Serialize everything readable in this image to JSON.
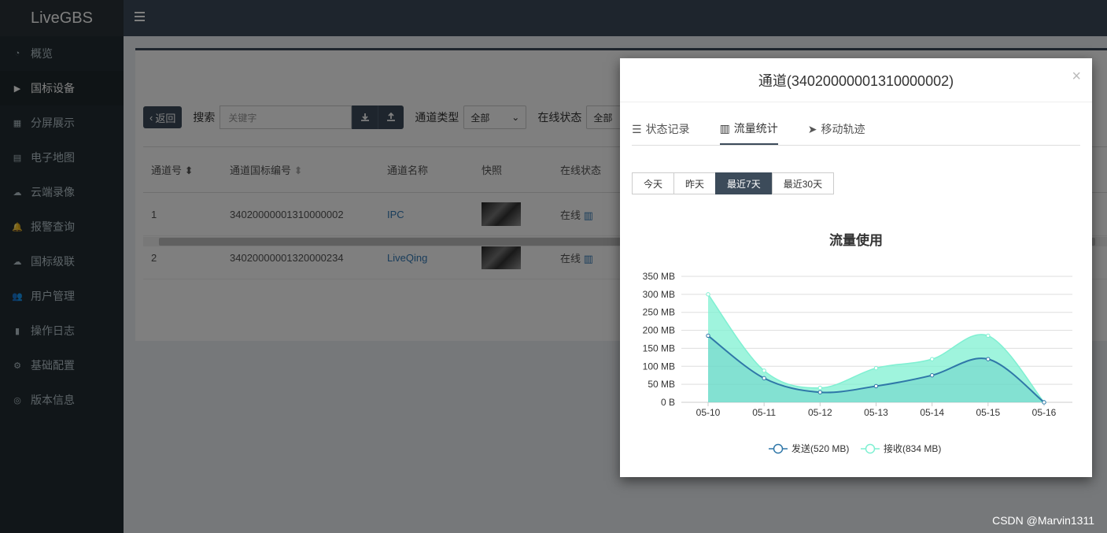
{
  "app": {
    "logo": "LiveGBS"
  },
  "sidebar": {
    "items": [
      {
        "label": "概览",
        "icon": "dashboard-icon"
      },
      {
        "label": "国标设备",
        "icon": "video-camera-icon"
      },
      {
        "label": "分屏展示",
        "icon": "grid-icon"
      },
      {
        "label": "电子地图",
        "icon": "map-icon"
      },
      {
        "label": "云端录像",
        "icon": "cloud-icon"
      },
      {
        "label": "报警查询",
        "icon": "bell-icon"
      },
      {
        "label": "国标级联",
        "icon": "cloud-upload-icon"
      },
      {
        "label": "用户管理",
        "icon": "users-icon"
      },
      {
        "label": "操作日志",
        "icon": "file-icon"
      },
      {
        "label": "基础配置",
        "icon": "cogs-icon"
      },
      {
        "label": "版本信息",
        "icon": "globe-icon"
      }
    ]
  },
  "toolbar": {
    "back_label": "返回",
    "search_label": "搜索",
    "search_placeholder": "关键字",
    "channel_type_label": "通道类型",
    "channel_type_value": "全部",
    "online_status_label": "在线状态",
    "online_status_value": "全部"
  },
  "table": {
    "headers": [
      "通道号",
      "通道国标编号",
      "通道名称",
      "快照",
      "在线状态"
    ],
    "rows": [
      {
        "no": "1",
        "code": "34020000001310000002",
        "name": "IPC",
        "status": "在线"
      },
      {
        "no": "2",
        "code": "34020000001320000234",
        "name": "LiveQing",
        "status": "在线"
      }
    ]
  },
  "modal": {
    "title": "通道(34020000001310000002)",
    "close": "×",
    "tabs": [
      {
        "label": "状态记录",
        "icon": "list-icon"
      },
      {
        "label": "流量统计",
        "icon": "bar-chart-icon"
      },
      {
        "label": "移动轨迹",
        "icon": "location-arrow-icon"
      }
    ],
    "active_tab": 1,
    "ranges": [
      "今天",
      "昨天",
      "最近7天",
      "最近30天"
    ],
    "active_range": 2
  },
  "chart_data": {
    "type": "area",
    "title": "流量使用",
    "categories": [
      "05-10",
      "05-11",
      "05-12",
      "05-13",
      "05-14",
      "05-15",
      "05-16"
    ],
    "y_ticks": [
      "0 B",
      "50 MB",
      "100 MB",
      "150 MB",
      "200 MB",
      "250 MB",
      "300 MB",
      "350 MB"
    ],
    "ylim": [
      0,
      350
    ],
    "unit": "MB",
    "grid": true,
    "legend_position": "bottom",
    "series": [
      {
        "name": "发送(520 MB)",
        "values": [
          185,
          67,
          28,
          45,
          75,
          120,
          0
        ],
        "color": "#2f77a8"
      },
      {
        "name": "接收(834 MB)",
        "values": [
          300,
          88,
          40,
          95,
          120,
          185,
          0
        ],
        "color": "#7ff0d2"
      }
    ]
  },
  "watermark": "CSDN @Marvin1311",
  "colors": {
    "sidebar": "#222d32",
    "header": "#3c4b5a",
    "accent": "#3c4b5a",
    "link": "#337ab7"
  }
}
